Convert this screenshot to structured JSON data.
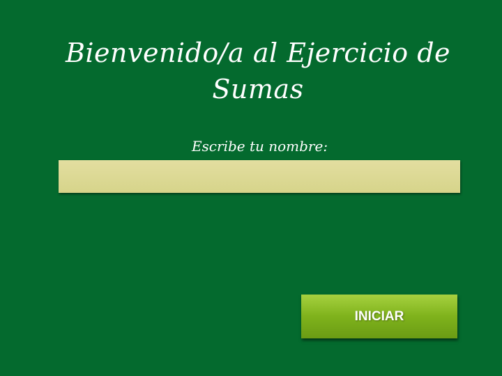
{
  "title": "Bienvenido/a al Ejercicio de Sumas",
  "prompt": "Escribe tu nombre:",
  "name_input": {
    "value": "",
    "placeholder": ""
  },
  "start_button": {
    "label": "INICIAR"
  },
  "colors": {
    "background": "#046a2e",
    "input_fill": "#dcd995",
    "button_fill": "#7fb21c",
    "text": "#ffffff"
  }
}
